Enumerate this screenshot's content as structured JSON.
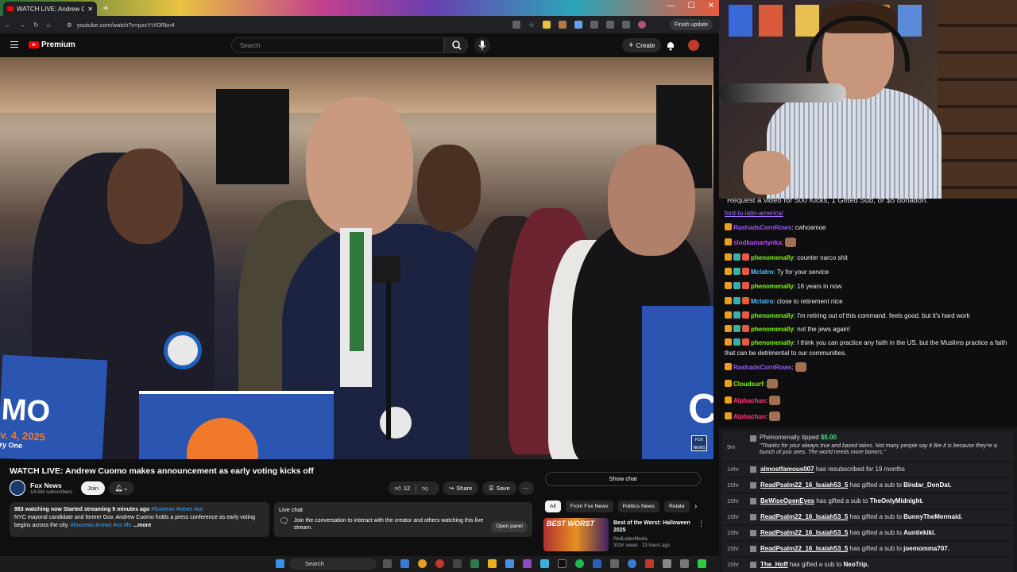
{
  "browser": {
    "tab_title": "WATCH LIVE: Andrew Cuomo m",
    "url": "youtube.com/watch?v=pzcYrX0Rbn4",
    "finish_update": "Finish update"
  },
  "youtube": {
    "logo_text": "Premium",
    "search_placeholder": "Search",
    "create_label": "Create",
    "video": {
      "title": "WATCH LIVE: Andrew Cuomo makes announcement as early voting kicks off",
      "sign_text": "MO",
      "sign_sub": "v. 4, 2025",
      "sign_tag": "ry One",
      "right_sign": "C",
      "news_bug": "FOX NEWS"
    },
    "channel": {
      "name": "Fox News",
      "subs": "14.5M subscribers",
      "join": "Join"
    },
    "actions": {
      "likes": "12",
      "share": "Share",
      "save": "Save"
    },
    "description": {
      "stats": "983 watching now  Started streaming 9 minutes ago",
      "stats_tags": "#foxnews #news #us",
      "text": "NYC mayoral candidate and former Gov. Andrew Cuomo holds a press conference as early voting begins across the city.",
      "tags": "#foxnews #news #us #fo",
      "more": "...more"
    },
    "livechat": {
      "title": "Live chat",
      "body": "Join the conversation to interact with the creator and others watching this live stream.",
      "open_panel": "Open panel"
    },
    "show_chat": "Show chat",
    "chips": [
      "All",
      "From Fox News",
      "Politics News",
      "Relate"
    ],
    "recommendation": {
      "thumb_text": "BEST WORST",
      "title": "Best of the Worst: Halloween 2025",
      "channel": "RedLetterMedia",
      "meta": "331K views · 23 hours ago"
    }
  },
  "taskbar": {
    "search_label": "Search"
  },
  "chat": {
    "banner": "Request a video for 500 Kicks, 1 Gifted Sub, or $5 donation.",
    "link": "ford-to-latin-america/",
    "messages": [
      {
        "user": "RashadsCornRows",
        "text": "cwhoamoe",
        "color": "#9b59ff"
      },
      {
        "user": "slodkamartynka",
        "text": "",
        "color": "#c04bff"
      },
      {
        "user": "phenomenally",
        "text": "counter narco shit",
        "color": "#7cfc00"
      },
      {
        "user": "Mclatro",
        "text": "Ty for your service",
        "color": "#4fc3ff"
      },
      {
        "user": "phenomenally",
        "text": "16 years in now",
        "color": "#7cfc00"
      },
      {
        "user": "Mclatro",
        "text": "close to retirement nice",
        "color": "#4fc3ff"
      },
      {
        "user": "phenomenally",
        "text": "I'm retiring out of this command. feels good. but it's hard work",
        "color": "#7cfc00"
      },
      {
        "user": "phenomenally",
        "text": "not the jews again!",
        "color": "#7cfc00"
      },
      {
        "user": "phenomenally",
        "text": "I think you can practice any faith in the US. but the Muslims practice a faith that can be detrimental to our communities.",
        "color": "#7cfc00"
      },
      {
        "user": "RashadsCornRows",
        "text": "",
        "color": "#9b59ff"
      },
      {
        "user": "Cloudsurf",
        "text": "",
        "color": "#7cfc00"
      },
      {
        "user": "Alphachan",
        "text": "",
        "color": "#ff3a7a"
      },
      {
        "user": "Alphachan",
        "text": "",
        "color": "#ff3a7a"
      }
    ]
  },
  "events": {
    "tip": {
      "time": "9m",
      "title": "Phenomenally tipped",
      "amount": "$5.00",
      "message": "\"Thanks for your always true and based takes. Not many people say it like it is because they're a bunch of poo sees. The world needs more boners.\""
    },
    "rows": [
      {
        "time": "14hr",
        "user": "almostfamous007",
        "text": " has resubscribed for 19 months",
        "target": ""
      },
      {
        "time": "15hr",
        "user": "ReadPsalm22_16_Isaiah53_5",
        "text": " has gifted a sub to ",
        "target": "Bindar_DonDat."
      },
      {
        "time": "15hr",
        "user": "BeWiseOpenEyes",
        "text": " has gifted a sub to ",
        "target": "TheOnlyMidnight."
      },
      {
        "time": "15hr",
        "user": "ReadPsalm22_16_Isaiah53_5",
        "text": " has gifted a sub to ",
        "target": "BunnyTheMermaid."
      },
      {
        "time": "15hr",
        "user": "ReadPsalm22_16_Isaiah53_5",
        "text": " has gifted a sub to ",
        "target": "Auntiekiki."
      },
      {
        "time": "15hr",
        "user": "ReadPsalm22_16_Isaiah53_5",
        "text": " has gifted a sub to ",
        "target": "joemomma707."
      },
      {
        "time": "15hr",
        "user": "The_Hoff",
        "text": " has gifted a sub to ",
        "target": "NeoTrip."
      }
    ]
  },
  "colors": {
    "tip_green": "#3be37a",
    "link_purple": "#a970ff",
    "yt_red": "#ff0000"
  }
}
